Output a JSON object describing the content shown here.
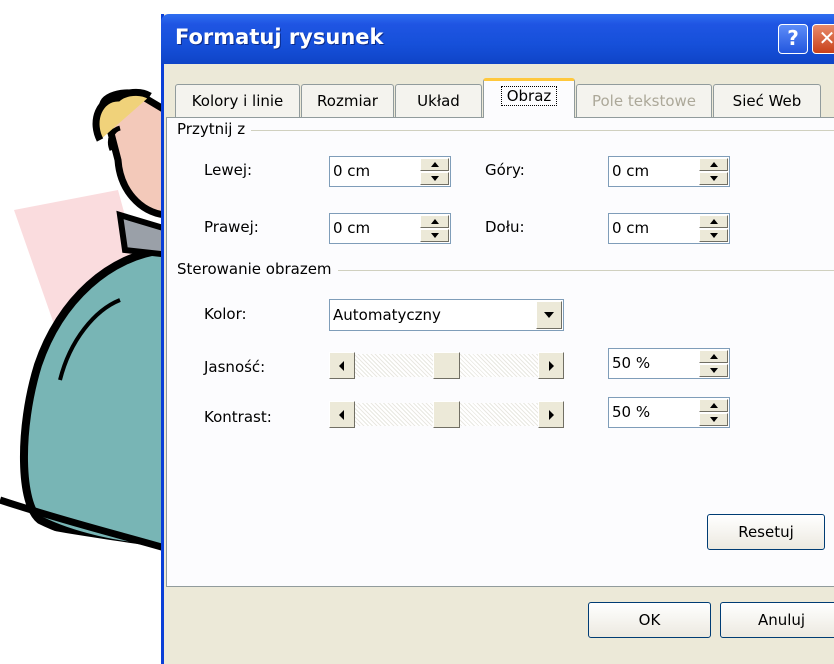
{
  "dialog": {
    "title": "Formatuj rysunek",
    "help_icon": "question-mark-icon",
    "close_icon": "close-x-icon"
  },
  "tabs": [
    {
      "label": "Kolory i linie",
      "state": "normal"
    },
    {
      "label": "Rozmiar",
      "state": "normal"
    },
    {
      "label": "Układ",
      "state": "normal"
    },
    {
      "label": "Obraz",
      "state": "active"
    },
    {
      "label": "Pole tekstowe",
      "state": "disabled"
    },
    {
      "label": "Sieć Web",
      "state": "normal"
    }
  ],
  "crop": {
    "group_label": "Przytnij z",
    "left": {
      "label": "Lewej:",
      "value": "0 cm"
    },
    "top": {
      "label": "Góry:",
      "value": "0 cm"
    },
    "right": {
      "label": "Prawej:",
      "value": "0 cm"
    },
    "bottom": {
      "label": "Dołu:",
      "value": "0 cm"
    }
  },
  "image_control": {
    "group_label": "Sterowanie obrazem",
    "color": {
      "label": "Kolor:",
      "value": "Automatyczny"
    },
    "brightness": {
      "label": "Jasność:",
      "value": "50 %",
      "level": 0.5
    },
    "contrast": {
      "label": "Kontrast:",
      "value": "50 %",
      "level": 0.5
    }
  },
  "buttons": {
    "reset": "Resetuj",
    "ok": "OK",
    "cancel": "Anuluj"
  },
  "colors": {
    "title_bar": "#1650da",
    "dialog_face": "#ece9d8",
    "active_tab_highlight": "#ffc83c"
  }
}
